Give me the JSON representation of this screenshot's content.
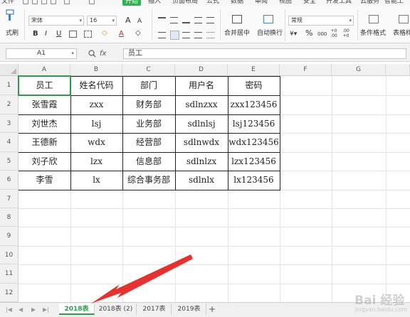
{
  "menubar": {
    "items": [
      "文件",
      "开始",
      "插入",
      "页面布局",
      "公式",
      "数据",
      "审阅",
      "视图",
      "安全",
      "开发工具",
      "云服务",
      "智能工"
    ]
  },
  "ribbon": {
    "format_painter": "式刷",
    "font_name": "宋体",
    "font_size": "16",
    "bold": "B",
    "italic": "I",
    "underline": "U",
    "font_color_letter": "A",
    "grow_font": "A",
    "shrink_font": "A",
    "merge_center": "合并居中",
    "auto_wrap": "自动换行",
    "number_format": "常规",
    "percent": "%",
    "thousands": "000",
    "dec_inc": "+0 .00",
    "dec_dec": ".00 +0",
    "conditional_format": "条件格式",
    "table_style": "表格样"
  },
  "formula_bar": {
    "name_box": "A1",
    "fx": "fx",
    "value": "员工"
  },
  "grid": {
    "columns": [
      "A",
      "B",
      "C",
      "D",
      "E",
      "F",
      "G"
    ],
    "rows": [
      "1",
      "2",
      "3",
      "4",
      "5",
      "6",
      "7",
      "8",
      "9",
      "10",
      "11",
      "12"
    ],
    "table": [
      [
        "员工",
        "姓名代码",
        "部门",
        "用户名",
        "密码"
      ],
      [
        "张雪霞",
        "zxx",
        "财务部",
        "sdlnzxx",
        "zxx123456"
      ],
      [
        "刘世杰",
        "lsj",
        "业务部",
        "sdlnlsj",
        "lsj123456"
      ],
      [
        "王德新",
        "wdx",
        "经营部",
        "sdlnwdx",
        "wdx123456"
      ],
      [
        "刘子欣",
        "lzx",
        "信息部",
        "sdlnlzx",
        "lzx123456"
      ],
      [
        "李雪",
        "lx",
        "综合事务部",
        "sdlnlx",
        "lx123456"
      ]
    ]
  },
  "sheet_tabs": {
    "tabs": [
      "2018表",
      "2018表 (2)",
      "2017表",
      "2019表"
    ],
    "active": "2018表",
    "add": "+"
  },
  "watermark": {
    "text": "Bai 经验",
    "sub": "jingyan.baidu.com"
  },
  "colors": {
    "accent_green": "#2db44c",
    "selection_green": "#2e9b4b",
    "arrow_red": "#e8312e"
  }
}
